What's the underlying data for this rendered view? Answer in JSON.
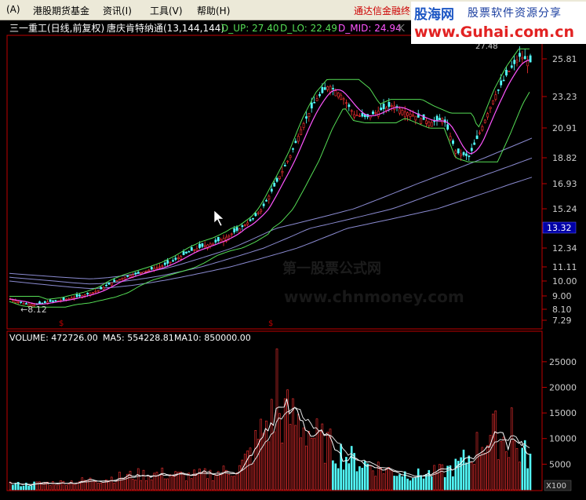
{
  "menu": {
    "items": [
      {
        "label": "(A)"
      },
      {
        "label": "港股期货基金"
      },
      {
        "label": "资讯(I)"
      },
      {
        "label": "工具(V)"
      },
      {
        "label": "帮助(H)"
      }
    ],
    "broker_link": "通达信金融终"
  },
  "watermark": {
    "brand": "股海网",
    "tagline": "股票软件资源分享",
    "url": "www.Guhai.com.cn"
  },
  "center_watermark": {
    "line1": "第一股票公式网",
    "line2": "www.chnmoney.com"
  },
  "price_panel": {
    "stock_title": "三一重工(日线,前复权)",
    "indicator_name": "唐庆肯特纳通(13,144,144)",
    "d_up": "D_UP: 27.40",
    "d_lo": "D_LO: 22.49",
    "d_mid": "D_MID: 24.94",
    "k_marker": "K",
    "high_label": "27.48",
    "low_label": "←8.12",
    "current_price": "13.32",
    "y_ticks": [
      "25.81",
      "23.23",
      "20.91",
      "18.82",
      "16.93",
      "15.24",
      "13.32",
      "12.34",
      "11.11",
      "10.00",
      "9.00",
      "8.10",
      "7.29"
    ],
    "colors": {
      "up": "#ff3333",
      "down": "#54ffff",
      "channel": "#55dd55",
      "mid": "#ff55ff",
      "long_ma": "#8a8ad0",
      "current_bg": "#0000a8"
    }
  },
  "volume_panel": {
    "title": "VOLUME: 472726.00",
    "ma5": "MA5: 554228.81",
    "ma10": "MA10: 850000.00",
    "y_ticks": [
      "25000",
      "20000",
      "15000",
      "10000",
      "5000"
    ],
    "unit": "X100"
  },
  "chart_data": {
    "type": "candlestick",
    "price": {
      "axis_ticks": [
        25.81,
        23.23,
        20.91,
        18.82,
        16.93,
        15.24,
        13.32,
        12.34,
        11.11,
        10.0,
        9.0,
        8.1,
        7.29
      ],
      "ylim": [
        7.29,
        27.48
      ],
      "high": 27.48,
      "low": 8.12,
      "last": 13.32,
      "close_path": [
        8.8,
        8.5,
        8.4,
        8.6,
        8.7,
        8.9,
        9.1,
        9.4,
        9.9,
        10.3,
        10.6,
        10.9,
        11.2,
        11.6,
        12.1,
        12.4,
        12.6,
        12.9,
        13.3,
        14.2,
        15.6,
        17.2,
        19.0,
        21.2,
        23.0,
        24.0,
        23.3,
        21.9,
        21.7,
        22.2,
        22.6,
        22.1,
        21.7,
        21.3,
        21.6,
        19.2,
        18.9,
        20.9,
        23.2,
        24.8,
        26.0,
        25.5
      ],
      "series": [
        {
          "name": "D_UP",
          "last": 27.4
        },
        {
          "name": "D_LO",
          "last": 22.49
        },
        {
          "name": "D_MID",
          "last": 24.94
        }
      ]
    },
    "volume": {
      "axis_ticks": [
        25000,
        20000,
        15000,
        10000,
        5000
      ],
      "ylim": [
        0,
        28500
      ],
      "unit": "X100",
      "profile": [
        1200,
        1000,
        1200,
        1300,
        1400,
        1600,
        1800,
        2000,
        2300,
        2600,
        2900,
        3000,
        3100,
        2800,
        2700,
        2900,
        3200,
        3600,
        4200,
        7500,
        12500,
        14500,
        14000,
        12800,
        10000,
        8500,
        7000,
        5800,
        4900,
        4300,
        3600,
        3200,
        2900,
        3200,
        3600,
        4500,
        6500,
        9500,
        11000,
        9500,
        7500,
        6000
      ],
      "spikes": [
        {
          "x": 351,
          "v": 27500
        },
        {
          "x": 650,
          "v": 16000
        }
      ],
      "ma5_last": 554228.81,
      "ma10_last": 850000.0
    }
  }
}
